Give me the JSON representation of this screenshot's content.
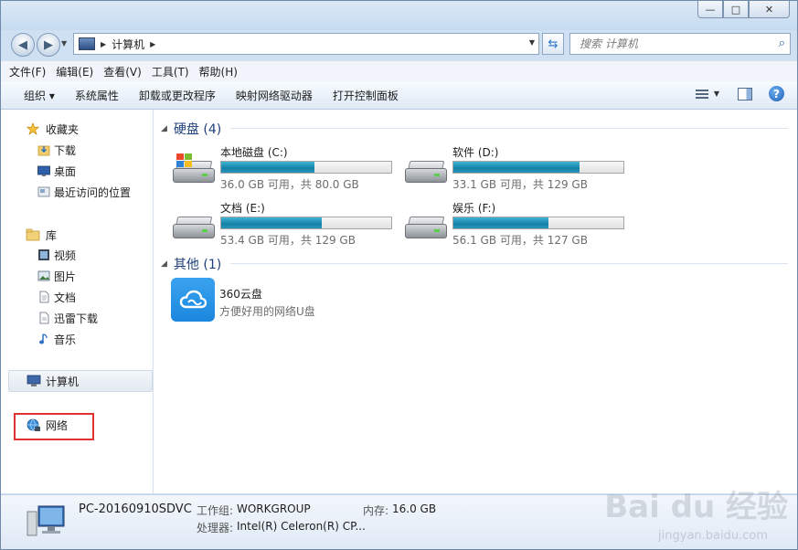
{
  "window": {
    "caption_buttons": {
      "minimize": "—",
      "maximize": "□",
      "close": "✕"
    }
  },
  "nav": {
    "back_glyph": "◀",
    "forward_glyph": "▶",
    "breadcrumb": "计算机",
    "search_placeholder": "搜索 计算机"
  },
  "menu": [
    "文件(F)",
    "编辑(E)",
    "查看(V)",
    "工具(T)",
    "帮助(H)"
  ],
  "toolbar": {
    "organize": "组织 ▾",
    "items": [
      "系统属性",
      "卸载或更改程序",
      "映射网络驱动器",
      "打开控制面板"
    ]
  },
  "sidebar": {
    "favorites": {
      "label": "收藏夹",
      "items": [
        "下载",
        "桌面",
        "最近访问的位置"
      ]
    },
    "libraries": {
      "label": "库",
      "items": [
        "视频",
        "图片",
        "文档",
        "迅雷下载",
        "音乐"
      ]
    },
    "computer": "计算机",
    "network": "网络"
  },
  "main": {
    "hdd_section": "硬盘 (4)",
    "drives": [
      {
        "name": "本地磁盘 (C:)",
        "free_text": "36.0 GB 可用，共 80.0 GB",
        "used_fraction": 0.55
      },
      {
        "name": "软件 (D:)",
        "free_text": "33.1 GB 可用，共 129 GB",
        "used_fraction": 0.74
      },
      {
        "name": "文档 (E:)",
        "free_text": "53.4 GB 可用，共 129 GB",
        "used_fraction": 0.59
      },
      {
        "name": "娱乐 (F:)",
        "free_text": "56.1 GB 可用，共 127 GB",
        "used_fraction": 0.56
      }
    ],
    "other_section": "其他 (1)",
    "cloud": {
      "title": "360云盘",
      "subtitle": "方便好用的网络U盘"
    }
  },
  "details": {
    "pc_name": "PC-20160910SDVC",
    "workgroup_label": "工作组:",
    "workgroup_value": "WORKGROUP",
    "memory_label": "内存:",
    "memory_value": "16.0 GB",
    "processor_label": "处理器:",
    "processor_value": "Intel(R) Celeron(R) CP..."
  },
  "watermark": {
    "main": "Bai du 经验",
    "sub": "jingyan.baidu.com"
  },
  "colors": {
    "bar_fill": "#1481a6",
    "highlight_box": "#e03030",
    "link_blue": "#1e3f7a"
  }
}
